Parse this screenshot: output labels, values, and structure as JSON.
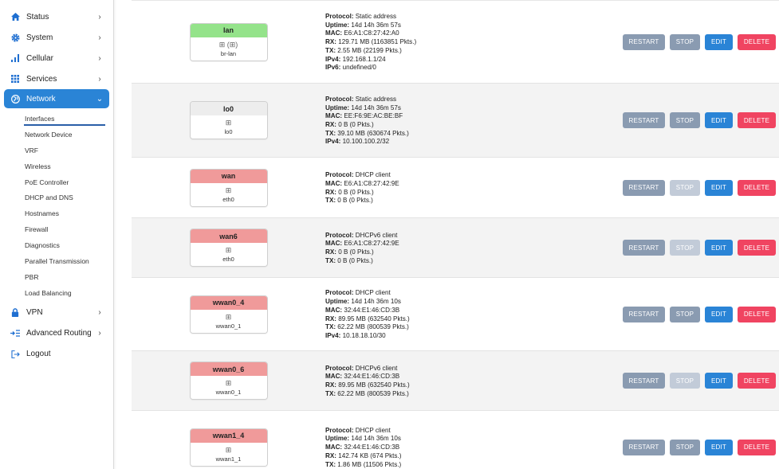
{
  "sidebar": {
    "items": [
      {
        "label": "Status",
        "icon": "home-icon"
      },
      {
        "label": "System",
        "icon": "gear-icon"
      },
      {
        "label": "Cellular",
        "icon": "signal-bars-icon"
      },
      {
        "label": "Services",
        "icon": "grid-icon"
      },
      {
        "label": "Network",
        "icon": "globe-icon"
      },
      {
        "label": "VPN",
        "icon": "lock-icon"
      },
      {
        "label": "Advanced Routing",
        "icon": "routing-icon"
      },
      {
        "label": "Logout",
        "icon": "logout-icon"
      }
    ],
    "network_sub": [
      "Interfaces",
      "Network Device",
      "VRF",
      "Wireless",
      "PoE Controller",
      "DHCP and DNS",
      "Hostnames",
      "Firewall",
      "Diagnostics",
      "Parallel Transmission",
      "PBR",
      "Load Balancing"
    ]
  },
  "buttons": {
    "restart": "RESTART",
    "stop": "STOP",
    "edit": "EDIT",
    "delete": "DELETE"
  },
  "labels": {
    "protocol": "Protocol:",
    "uptime": "Uptime:",
    "mac": "MAC:",
    "rx": "RX:",
    "tx": "TX:",
    "ipv4": "IPv4:",
    "ipv6": "IPv6:"
  },
  "colors": {
    "active": "#2a84d6",
    "delete": "#f04461",
    "neutral": "#8a9bb1",
    "up": "#94e38a",
    "down": "#f09a9a"
  },
  "interfaces": [
    {
      "name": "lan",
      "icons": "🔌 (🔌)",
      "device": "br-lan",
      "protocol": "Static address",
      "uptime": "14d 14h 36m 57s",
      "mac": "E6:A1:C8:27:42:A0",
      "rx": "129.71 MB (1163851 Pkts.)",
      "tx": "2.55 MB (22199 Pkts.)",
      "ipv4": "192.168.1.1/24",
      "ipv6": "undefined/0"
    },
    {
      "name": "lo0",
      "icons": "🔌",
      "device": "lo0",
      "protocol": "Static address",
      "uptime": "14d 14h 36m 57s",
      "mac": "EE:F6:9E:AC:BE:BF",
      "rx": "0 B (0 Pkts.)",
      "tx": "39.10 MB (630674 Pkts.)",
      "ipv4": "10.100.100.2/32"
    },
    {
      "name": "wan",
      "icons": "🔌",
      "device": "eth0",
      "protocol": "DHCP client",
      "mac": "E6:A1:C8:27:42:9E",
      "rx": "0 B (0 Pkts.)",
      "tx": "0 B (0 Pkts.)"
    },
    {
      "name": "wan6",
      "icons": "🔌",
      "device": "eth0",
      "protocol": "DHCPv6 client",
      "mac": "E6:A1:C8:27:42:9E",
      "rx": "0 B (0 Pkts.)",
      "tx": "0 B (0 Pkts.)"
    },
    {
      "name": "wwan0_4",
      "icons": "🔌",
      "device": "wwan0_1",
      "protocol": "DHCP client",
      "uptime": "14d 14h 36m 10s",
      "mac": "32:44:E1:46:CD:3B",
      "rx": "89.95 MB (632540 Pkts.)",
      "tx": "62.22 MB (800539 Pkts.)",
      "ipv4": "10.18.18.10/30"
    },
    {
      "name": "wwan0_6",
      "icons": "🔌",
      "device": "wwan0_1",
      "protocol": "DHCPv6 client",
      "mac": "32:44:E1:46:CD:3B",
      "rx": "89.95 MB (632540 Pkts.)",
      "tx": "62.22 MB (800539 Pkts.)"
    },
    {
      "name": "wwan1_4",
      "icons": "🔌",
      "device": "wwan1_1",
      "protocol": "DHCP client",
      "uptime": "14d 14h 36m 10s",
      "mac": "32:44:E1:46:CD:3B",
      "rx": "142.74 KB (674 Pkts.)",
      "tx": "1.86 MB (11506 Pkts.)"
    }
  ]
}
